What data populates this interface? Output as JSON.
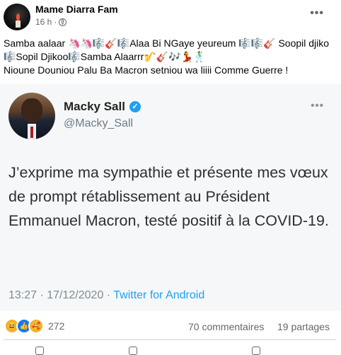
{
  "post": {
    "author": "Mame Diarra Fam",
    "time": "16 h",
    "separator": "·",
    "caption_parts": [
      "Samba aalaar 🦄🦄🎼🎸🎼Alaa Bi NGaye yeureum 🎼🎼🎸 Soopil djiko 🎼Sopil Djikoo🎼Samba Alaarrr🎷🎸🎶💃🕺",
      "Nioune Douniou Palu Ba Macron setniou wa liiii Comme Guerre !"
    ]
  },
  "tweet": {
    "name": "Macky Sall",
    "handle": "@Macky_Sall",
    "text": "J’exprime ma sympathie et présente mes vœux de prompt rétablissement au Président Emmanuel Macron, testé positif à la COVID-19.",
    "timestamp": "13:27 · 17/12/2020 · ",
    "source": "Twitter for Android"
  },
  "stats": {
    "reactions": "272",
    "comments": "70 commentaires",
    "shares": "19 partages"
  },
  "icons": [
    "globe-icon",
    "more-icon",
    "verified-icon",
    "haha-icon",
    "like-icon",
    "care-icon"
  ],
  "colors": {
    "twitter_blue": "#1da1f2",
    "facebook_blue": "#1877f2",
    "muted": "#65676b"
  }
}
